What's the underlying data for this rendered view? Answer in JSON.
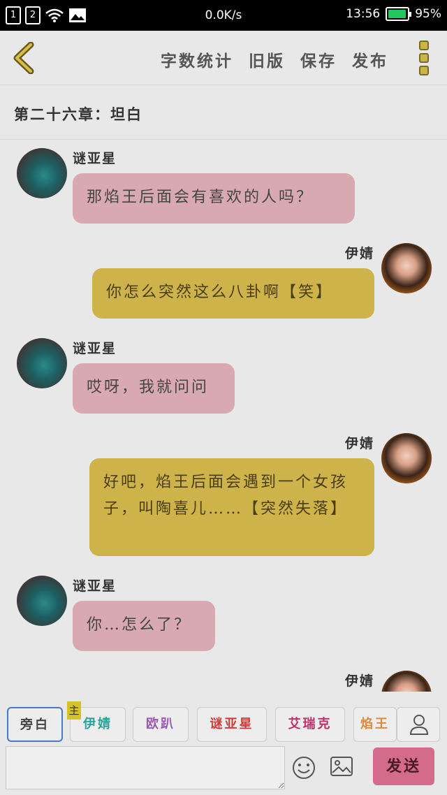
{
  "status_bar": {
    "sim1": "1",
    "sim2": "2",
    "net_speed": "0.0K/s",
    "time": "13:56",
    "battery": "95%",
    "battery_level": 0.95,
    "icons": [
      "sim-icon",
      "wifi-icon",
      "image-icon",
      "battery-icon"
    ]
  },
  "toolbar": {
    "word_count": "字数统计",
    "old_version": "旧版",
    "save": "保存",
    "publish": "发布",
    "back_icon": "chevron-left-icon",
    "more_icon": "more-vertical-icon"
  },
  "chapter": {
    "title": "第二十六章：坦白"
  },
  "messages": [
    {
      "side": "left",
      "name": "谜亚星",
      "text": "那焰王后面会有喜欢的人吗？"
    },
    {
      "side": "right",
      "name": "伊婧",
      "text": "你怎么突然这么八卦啊【笑】"
    },
    {
      "side": "left",
      "name": "谜亚星",
      "text": "哎呀，我就问问"
    },
    {
      "side": "right",
      "name": "伊婧",
      "text": "好吧，焰王后面会遇到一个女孩子，叫陶喜儿……【突然失落】"
    },
    {
      "side": "left",
      "name": "谜亚星",
      "text": "你…怎么了？"
    },
    {
      "side": "right",
      "name": "伊婧",
      "text": ""
    }
  ],
  "roles": {
    "items": [
      "旁白",
      "伊婧",
      "欧趴",
      "谜亚星",
      "艾瑞克",
      "焰王"
    ],
    "main_badge": "主",
    "colors": [
      "#444444",
      "#2aa39a",
      "#9b59b6",
      "#d33a3a",
      "#c0306a",
      "#e08a3a"
    ]
  },
  "input": {
    "placeholder": "",
    "send": "发送"
  },
  "colors": {
    "left_bubble": "#d9a9b1",
    "right_bubble": "#cdb34a",
    "send_button": "#d46a8c",
    "accent_icon": "#c8b64a"
  }
}
